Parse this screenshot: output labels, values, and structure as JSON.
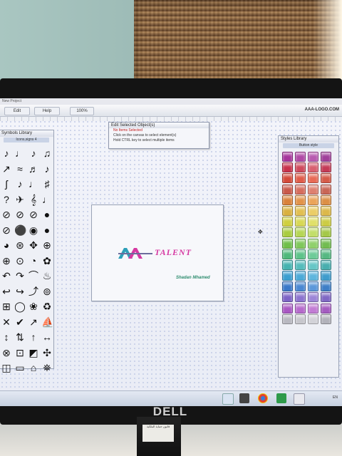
{
  "app": {
    "title": "New Project",
    "site": "AAA-LOGO.COM",
    "toolbar": {
      "edit_label": "Edit",
      "help_label": "Help",
      "zoom_value": "100%"
    }
  },
  "left_panel": {
    "title": "Symbols Library",
    "category": "Icons,signs 4",
    "symbols": [
      "♪",
      "♩",
      "♪",
      "♫",
      "↗",
      "≈",
      "♬",
      "♪",
      "ʃ",
      "♪",
      "♩",
      "♯",
      "?",
      "✈",
      "𝄞",
      "♩",
      "⊘",
      "⊘",
      "⊘",
      "●",
      "⊘",
      "⚫",
      "◉",
      "●",
      "◕",
      "⊛",
      "✥",
      "⊕",
      "⊕",
      "⊙",
      "◔",
      "✿",
      "↶",
      "↷",
      "⌒",
      "♨",
      "↩",
      "↪",
      "⤴",
      "⊚",
      "⊞",
      "◯",
      "❀",
      "♻",
      "✕",
      "✔",
      "↗",
      "⛵",
      "↕",
      "⇅",
      "↑",
      "↔",
      "⊗",
      "⊡",
      "◩",
      "✣",
      "◫",
      "▭",
      "⌂",
      "⛯",
      "⚒",
      "⬭",
      "☖",
      "♦"
    ]
  },
  "popup": {
    "title": "Edit Selected Object(s)",
    "warning": "No Items Selected",
    "line1": "Click on the canvas to select element(s)",
    "line2": "Hold CTRL key to select multiple items"
  },
  "canvas": {
    "logo_text": "TALENT",
    "signature": "Shadan Mhamed"
  },
  "right_panel": {
    "title": "Styles Library",
    "category": "Button style",
    "colors": [
      "#a6359c",
      "#b04aa6",
      "#b85bb0",
      "#a0409a",
      "#c8324c",
      "#cf4a5d",
      "#d86070",
      "#c43a55",
      "#d4493a",
      "#e05c4a",
      "#e86a55",
      "#d55a48",
      "#c9584a",
      "#d66d5e",
      "#de8070",
      "#c96555",
      "#d9803a",
      "#e2934a",
      "#eba45a",
      "#dc8f45",
      "#d9b040",
      "#e2bf52",
      "#ebcd66",
      "#dcb84a",
      "#cfcf3f",
      "#d8d855",
      "#e0e06a",
      "#cccc45",
      "#a9cc40",
      "#b6d655",
      "#c2de6a",
      "#a4c848",
      "#6fbf4a",
      "#80c85c",
      "#90d06c",
      "#72bc50",
      "#4fb87a",
      "#5ec38a",
      "#6dcb98",
      "#55b882",
      "#45b3b0",
      "#55bcbc",
      "#66c6c6",
      "#48aeae",
      "#3b9fd0",
      "#4caad8",
      "#5fb6de",
      "#3f9ccc",
      "#3a78c8",
      "#4a88d2",
      "#5c98da",
      "#3e7ec6",
      "#7d63c6",
      "#8c74cf",
      "#9c86d7",
      "#7f67c4",
      "#a957c3",
      "#b66acc",
      "#c27cd4",
      "#a45bc0",
      "#b8b8c0",
      "#c6c6cc",
      "#d2d2d8",
      "#b2b2ba"
    ]
  },
  "taskbar": {
    "tray_text": "EN"
  },
  "monitor": {
    "brand": "DELL",
    "sticker_text": "قانون حماية الملكية"
  }
}
